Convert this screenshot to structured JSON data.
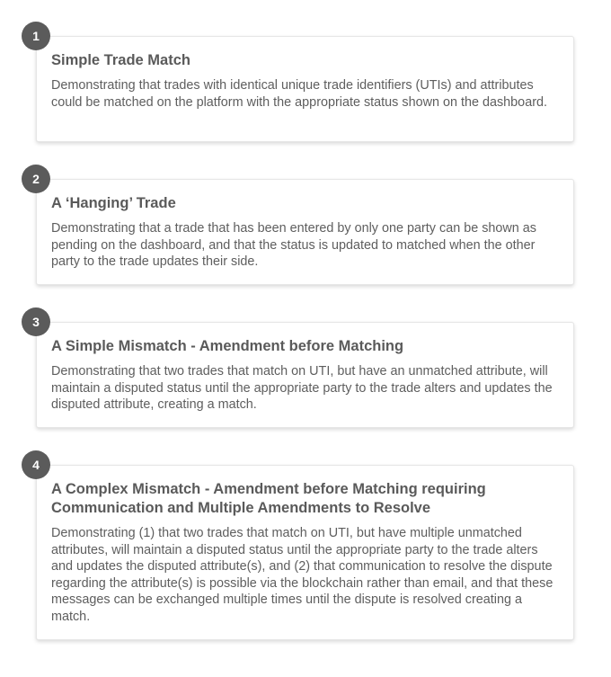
{
  "steps": [
    {
      "number": "1",
      "title": "Simple Trade Match",
      "description": "Demonstrating that trades with identical unique trade identifiers (UTIs) and attributes could be matched on the platform with the appropriate status shown on the dashboard."
    },
    {
      "number": "2",
      "title": "A ‘Hanging’ Trade",
      "description": "Demonstrating that a trade that has been entered by only one party can be shown as pending on the dashboard, and that the status is updated to matched when the other party to the trade updates their side."
    },
    {
      "number": "3",
      "title": "A Simple Mismatch - Amendment before Matching",
      "description": "Demonstrating that two trades that match on UTI, but have an unmatched attribute, will maintain a disputed status until the appropriate party to the trade alters and updates the disputed attribute, creating a match."
    },
    {
      "number": "4",
      "title": "A Complex Mismatch - Amendment before Matching requiring Communication and Multiple Amendments to Resolve",
      "description": "Demonstrating (1) that two trades that match on UTI, but have multiple unmatched attributes, will maintain a disputed status until the appropriate party to the trade alters and updates the disputed attribute(s), and (2) that communication to resolve the dispute regarding the attribute(s) is possible via the blockchain rather than email, and that these messages can be exchanged multiple times until the dispute is resolved creating a match."
    }
  ]
}
